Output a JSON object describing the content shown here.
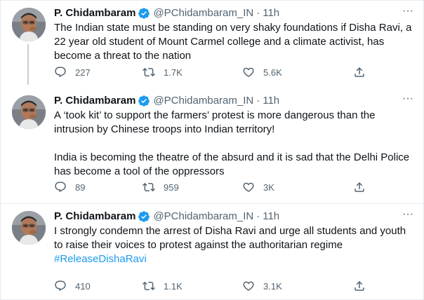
{
  "colors": {
    "text": "#0f1419",
    "secondary": "#536471",
    "link": "#1d9bf0",
    "verified": "#1d9bf0",
    "thread_line": "#c4cfd6"
  },
  "tweets": [
    {
      "name": "P. Chidambaram",
      "handle": "@PChidambaram_IN",
      "separator": "·",
      "time": "11h",
      "more": "···",
      "text": [
        "The Indian state must be standing on very shaky foundations if Disha Ravi, a  22 year old student of Mount Carmel college and a climate activist, has become a threat to the nation"
      ],
      "hashtag": "",
      "replies": "227",
      "retweets": "1.7K",
      "likes": "5.6K"
    },
    {
      "name": "P. Chidambaram",
      "handle": "@PChidambaram_IN",
      "separator": "·",
      "time": "11h",
      "more": "···",
      "text": [
        "A ‘took kit’ to support the farmers’ protest is more dangerous than the intrusion by Chinese troops into Indian territory!",
        "India is becoming the theatre of the absurd and it is sad that the Delhi Police has become a tool of the oppressors"
      ],
      "hashtag": "",
      "replies": "89",
      "retweets": "959",
      "likes": "3K"
    },
    {
      "name": "P. Chidambaram",
      "handle": "@PChidambaram_IN",
      "separator": "·",
      "time": "11h",
      "more": "···",
      "text": [
        "I strongly condemn the arrest of Disha Ravi and urge all students and youth to raise their voices to protest against the authoritarian regime"
      ],
      "hashtag": "#ReleaseDishaRavi",
      "replies": "410",
      "retweets": "1.1K",
      "likes": "3.1K"
    }
  ],
  "icons": {
    "reply": "reply-icon",
    "retweet": "retweet-icon",
    "like": "like-icon",
    "share": "share-icon",
    "verified": "verified-badge-icon",
    "more": "more-options-icon"
  }
}
